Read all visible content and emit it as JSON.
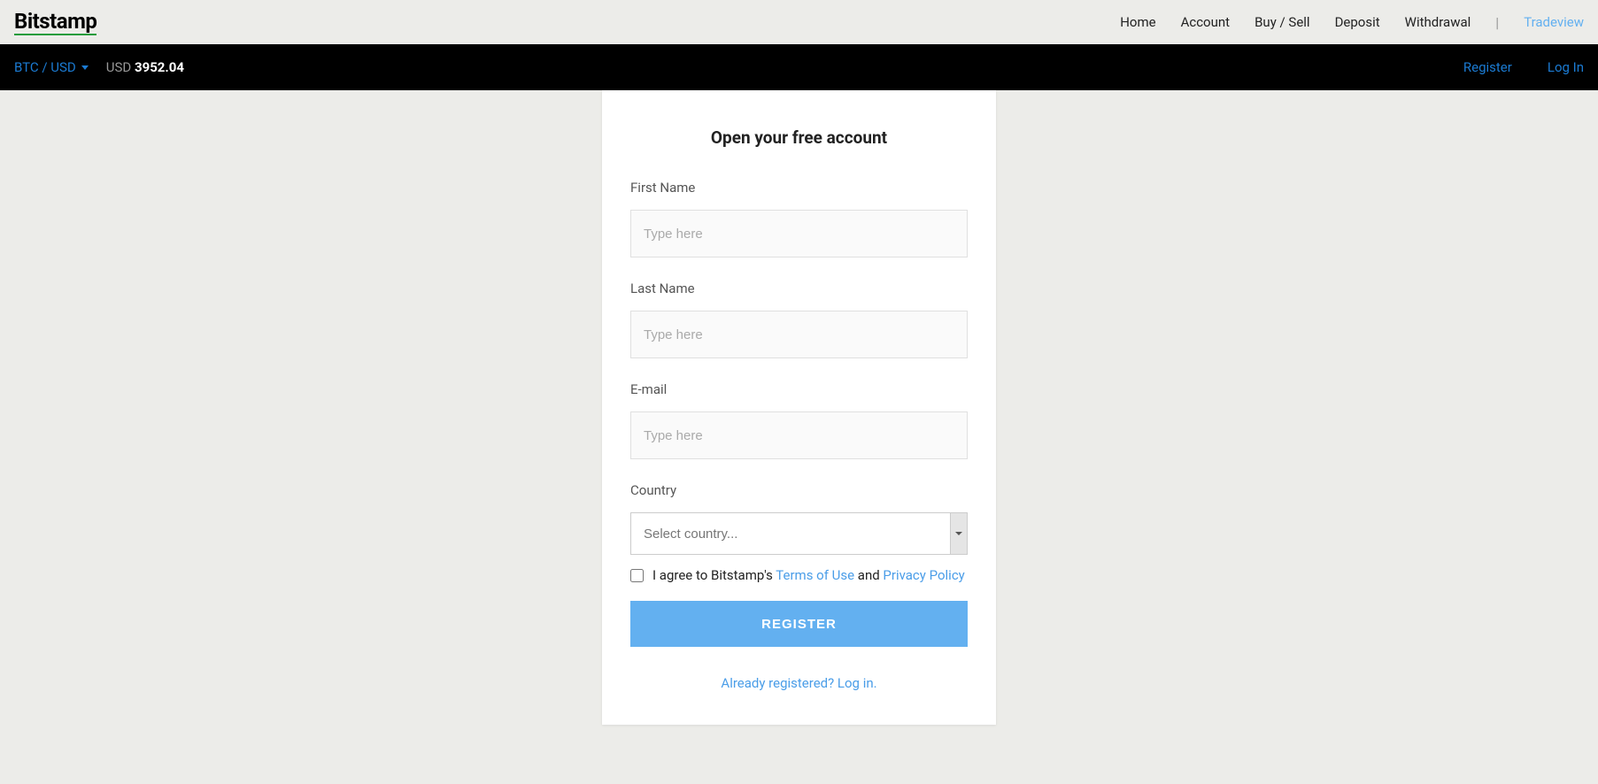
{
  "header": {
    "logo": "Bitstamp",
    "nav": {
      "home": "Home",
      "account": "Account",
      "buysell": "Buy / Sell",
      "deposit": "Deposit",
      "withdrawal": "Withdrawal",
      "tradeview": "Tradeview"
    }
  },
  "subheader": {
    "pair": "BTC / USD",
    "currency_label": "USD",
    "price": "3952.04",
    "register": "Register",
    "login": "Log In"
  },
  "form": {
    "title": "Open your free account",
    "first_name_label": "First Name",
    "first_name_placeholder": "Type here",
    "last_name_label": "Last Name",
    "last_name_placeholder": "Type here",
    "email_label": "E-mail",
    "email_placeholder": "Type here",
    "country_label": "Country",
    "country_placeholder": "Select country...",
    "agree_prefix": "I agree to Bitstamp's ",
    "terms": "Terms of Use",
    "and": " and ",
    "privacy": "Privacy Policy",
    "register_button": "REGISTER",
    "already_registered": "Already registered? Log in."
  }
}
